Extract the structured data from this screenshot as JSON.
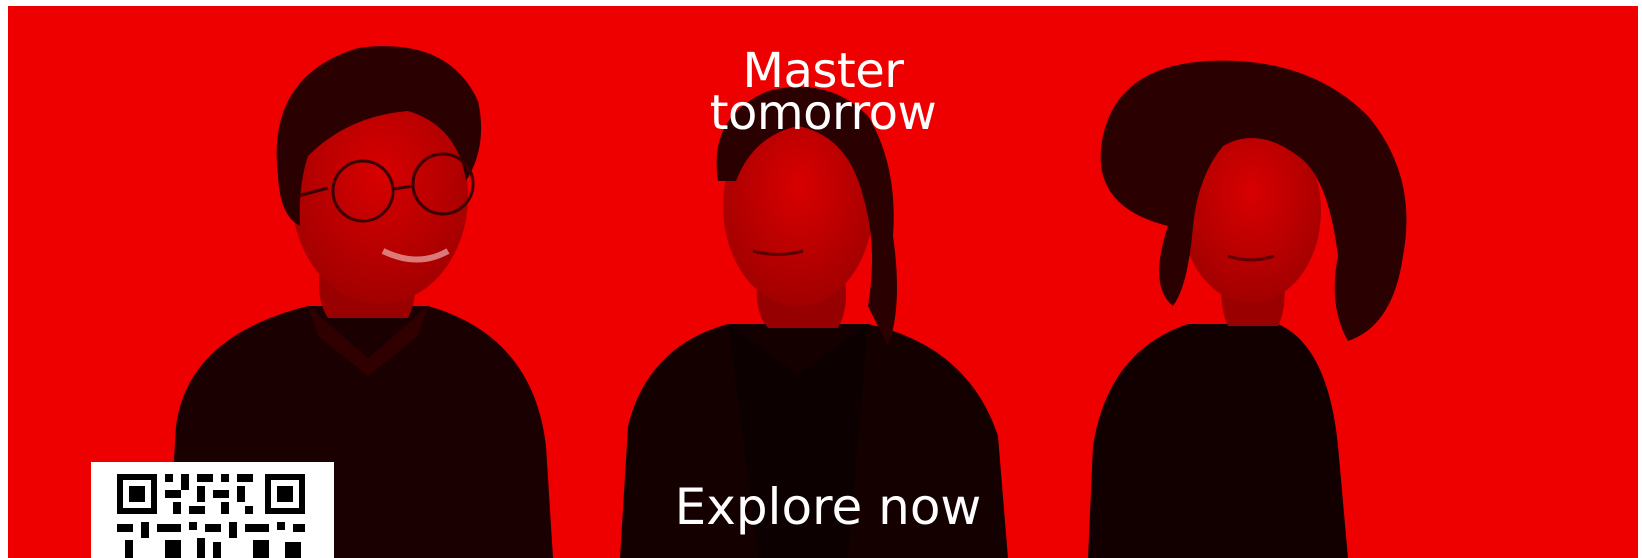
{
  "banner": {
    "headline_line1": "Master",
    "headline_line2": "tomorrow",
    "cta_label": "Explore now",
    "background_color": "#ee0000",
    "text_color": "#ffffff"
  },
  "qr": {
    "icon": "qr-code-icon"
  },
  "people": [
    {
      "icon": "person-with-glasses-photo"
    },
    {
      "icon": "person-center-photo"
    },
    {
      "icon": "person-curly-hair-photo"
    }
  ]
}
